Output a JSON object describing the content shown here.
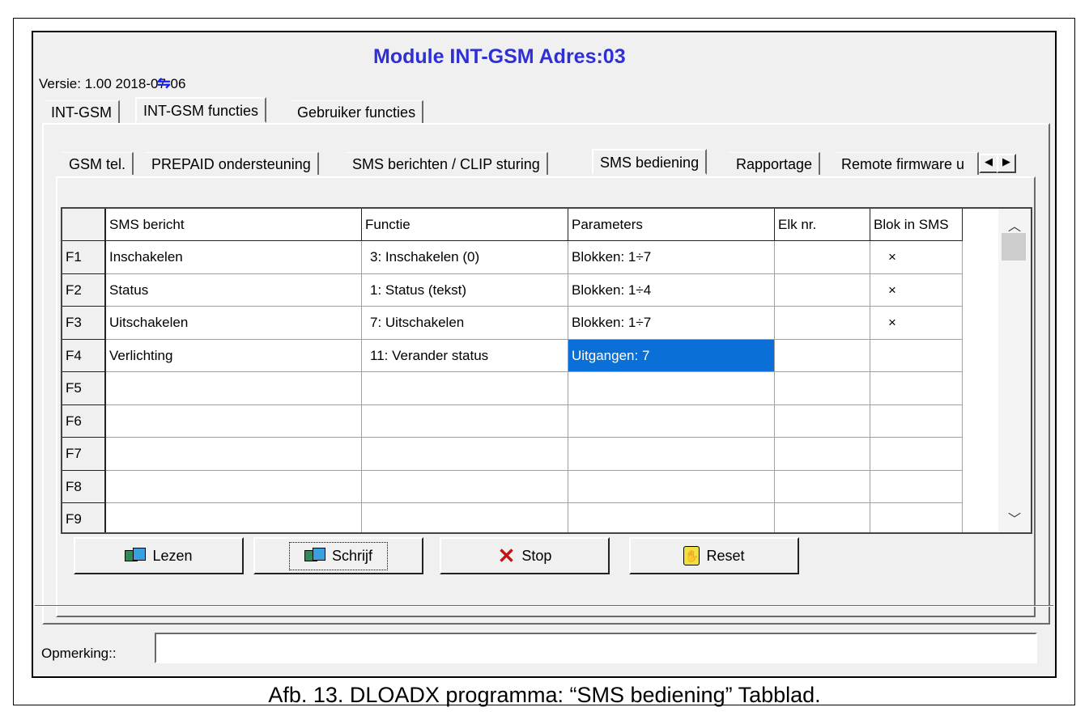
{
  "window": {
    "title": "Module INT-GSM Adres:03",
    "version": "Versie: 1.00 2018-07-06",
    "sync_icon": "sync-icon"
  },
  "main_tabs": [
    "INT-GSM",
    "INT-GSM functies",
    "Gebruiker functies"
  ],
  "sub_tabs": [
    "GSM tel.",
    "PREPAID ondersteuning",
    "SMS berichten / CLIP sturing",
    "SMS bediening",
    "Rapportage",
    "Remote firmware u"
  ],
  "grid": {
    "headers": [
      "SMS bericht",
      "Functie",
      "Parameters",
      "Elk nr.",
      "Blok in SMS"
    ],
    "rows": [
      {
        "id": "F1",
        "sms": "Inschakelen",
        "functie": "3: Inschakelen (0)",
        "param": "Blokken: 1÷7",
        "elk": "",
        "blok": "×"
      },
      {
        "id": "F2",
        "sms": "Status",
        "functie": "1: Status (tekst)",
        "param": "Blokken: 1÷4",
        "elk": "",
        "blok": "×"
      },
      {
        "id": "F3",
        "sms": "Uitschakelen",
        "functie": "7: Uitschakelen",
        "param": "Blokken: 1÷7",
        "elk": "",
        "blok": "×"
      },
      {
        "id": "F4",
        "sms": "Verlichting",
        "functie": "11: Verander status",
        "param": "Uitgangen: 7",
        "elk": "",
        "blok": ""
      },
      {
        "id": "F5",
        "sms": "",
        "functie": "",
        "param": "",
        "elk": "",
        "blok": ""
      },
      {
        "id": "F6",
        "sms": "",
        "functie": "",
        "param": "",
        "elk": "",
        "blok": ""
      },
      {
        "id": "F7",
        "sms": "",
        "functie": "",
        "param": "",
        "elk": "",
        "blok": ""
      },
      {
        "id": "F8",
        "sms": "",
        "functie": "",
        "param": "",
        "elk": "",
        "blok": ""
      },
      {
        "id": "F9",
        "sms": "",
        "functie": "",
        "param": "",
        "elk": "",
        "blok": ""
      }
    ]
  },
  "buttons": {
    "read": "Lezen",
    "write": "Schrijf",
    "stop": "Stop",
    "reset": "Reset"
  },
  "remark_label": "Opmerking::",
  "remark_value": "",
  "caption": "Afb. 13. DLOADX programma: “SMS bediening” Tabblad.",
  "colors": {
    "title": "#2f2fd6",
    "selection": "#0a6fd6"
  }
}
